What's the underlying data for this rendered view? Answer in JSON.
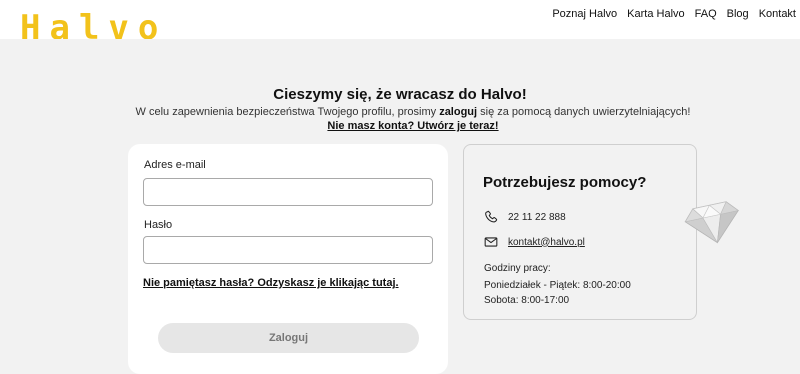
{
  "header": {
    "logo": "Halvo",
    "nav": [
      "Poznaj Halvo",
      "Karta Halvo",
      "FAQ",
      "Blog",
      "Kontakt"
    ]
  },
  "intro": {
    "title": "Cieszymy się, że wracasz do Halvo!",
    "subtitle_before": "W celu zapewnienia bezpieczeństwa Twojego profilu, prosimy ",
    "subtitle_bold": "zaloguj",
    "subtitle_after": " się za pomocą danych uwierzytelniających!",
    "signup_link": "Nie masz konta? Utwórz je teraz!"
  },
  "login": {
    "email_label": "Adres e-mail",
    "email_value": "",
    "password_label": "Hasło",
    "password_value": "",
    "forgot_link": "Nie pamiętasz hasła? Odzyskasz je klikając tutaj.",
    "submit_label": "Zaloguj"
  },
  "help": {
    "title": "Potrzebujesz pomocy?",
    "phone": "22 11 22 888",
    "email": "kontakt@halvo.pl",
    "hours_label": "Godziny pracy:",
    "hours_weekdays": "Poniedziałek - Piątek: 8:00-20:00",
    "hours_saturday": "Sobota: 8:00-17:00",
    "phone_icon": "phone-icon",
    "mail_icon": "mail-icon"
  },
  "colors": {
    "brand_yellow": "#f2c21b",
    "page_bg": "#f2f2f2",
    "button_bg": "#e6e6e6"
  }
}
